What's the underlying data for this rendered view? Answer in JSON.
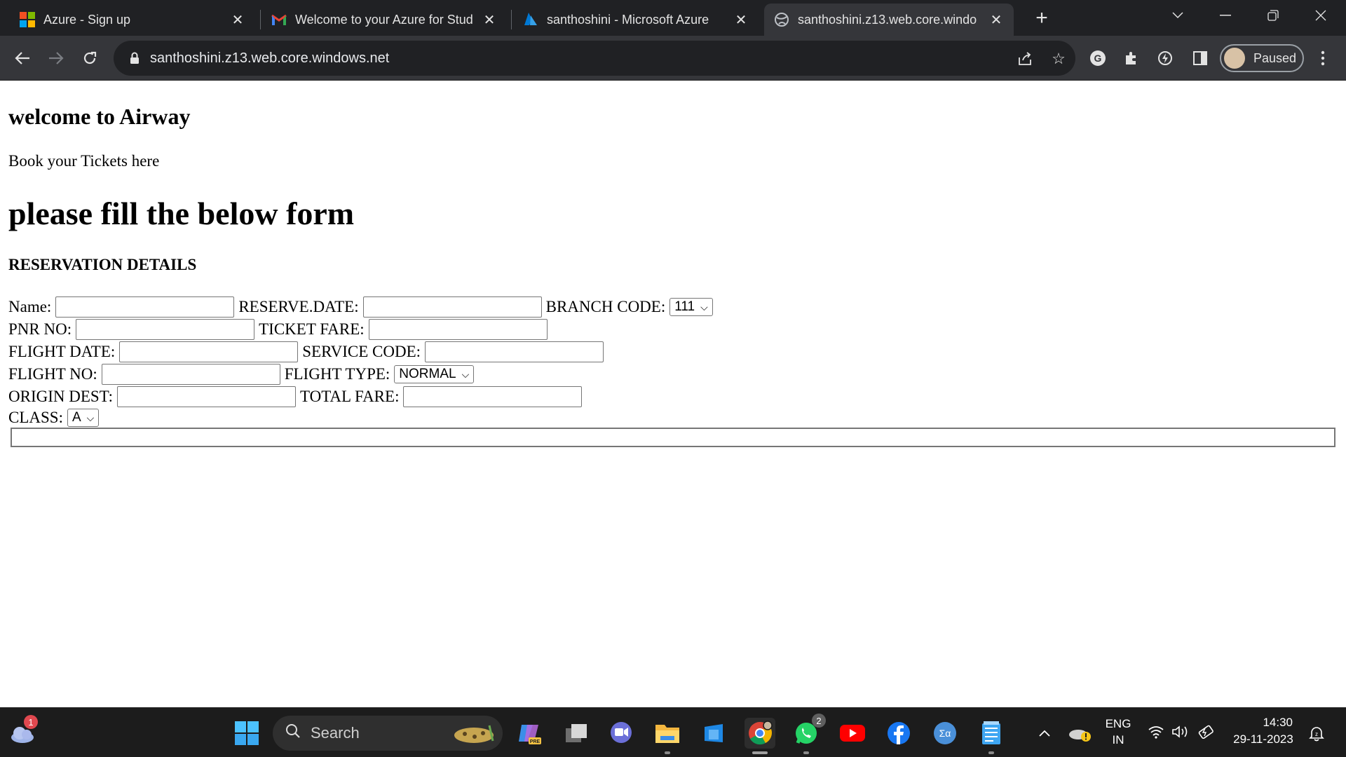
{
  "browser": {
    "tabs": [
      {
        "title": "Azure - Sign up",
        "icon": "microsoft-logo-icon",
        "active": false
      },
      {
        "title": "Welcome to your Azure for Stud",
        "icon": "gmail-icon",
        "active": false
      },
      {
        "title": "santhoshini - Microsoft Azure",
        "icon": "azure-logo-icon",
        "active": false
      },
      {
        "title": "santhoshini.z13.web.core.windo",
        "icon": "globe-icon",
        "active": true
      }
    ],
    "url": "santhoshini.z13.web.core.windows.net",
    "profile_status": "Paused"
  },
  "page": {
    "welcome_heading": "welcome to Airway",
    "subtitle": "Book your Tickets here",
    "form_heading": "please fill the below form",
    "section_title": "RESERVATION DETAILS",
    "fields": {
      "name": {
        "label": "Name:",
        "value": ""
      },
      "reserve_date": {
        "label": "RESERVE.DATE:",
        "value": ""
      },
      "branch_code": {
        "label": "BRANCH CODE:",
        "selected": "111"
      },
      "pnr_no": {
        "label": "PNR NO:",
        "value": ""
      },
      "ticket_fare": {
        "label": "TICKET FARE:",
        "value": ""
      },
      "flight_date": {
        "label": "FLIGHT DATE:",
        "value": ""
      },
      "service_code": {
        "label": "SERVICE CODE:",
        "value": ""
      },
      "flight_no": {
        "label": "FLIGHT NO:",
        "value": ""
      },
      "flight_type": {
        "label": "FLIGHT TYPE:",
        "selected": "NORMAL"
      },
      "origin_dest": {
        "label": "ORIGIN DEST:",
        "value": ""
      },
      "total_fare": {
        "label": "TOTAL FARE:",
        "value": ""
      },
      "class": {
        "label": "CLASS:",
        "selected": "A"
      }
    }
  },
  "taskbar": {
    "weather_badge": "1",
    "search_placeholder": "Search",
    "whatsapp_badge": "2",
    "language": {
      "line1": "ENG",
      "line2": "IN"
    },
    "time": "14:30",
    "date": "29-11-2023"
  },
  "colors": {
    "tabstrip_bg": "#202124",
    "toolbar_bg": "#35363a",
    "taskbar_bg": "#1c1c1c",
    "badge_red": "#e0484f"
  }
}
